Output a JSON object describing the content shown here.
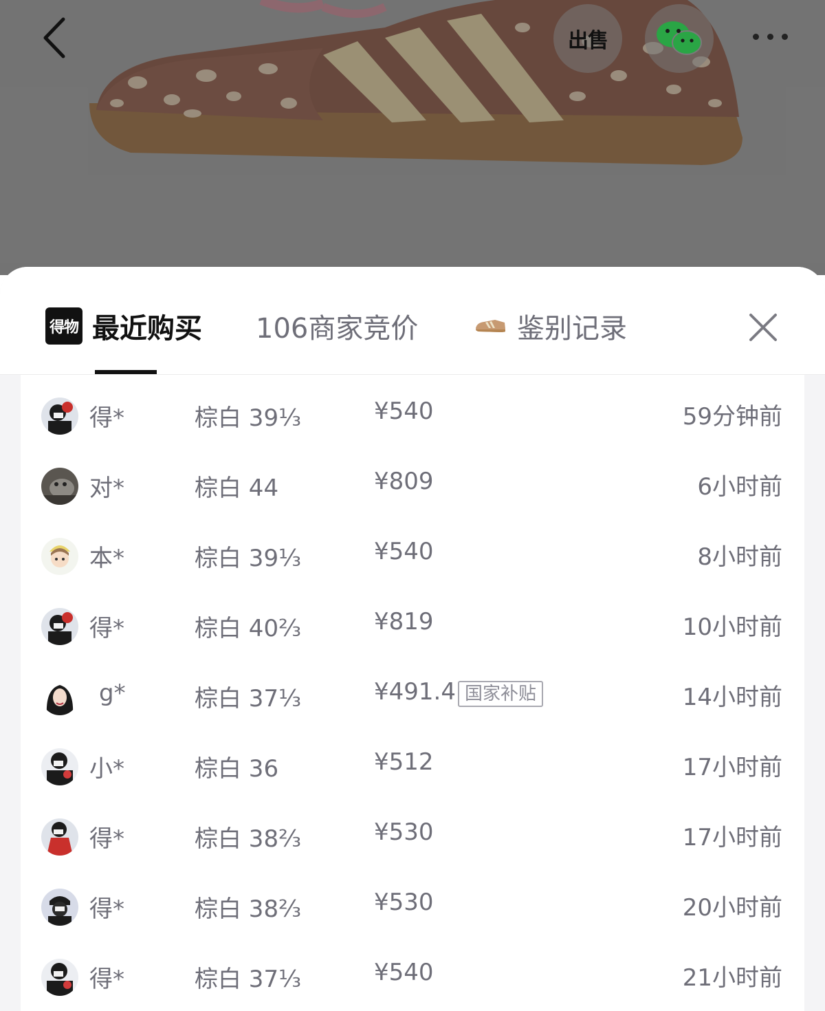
{
  "header": {
    "sell_label": "出售",
    "back_icon": "chevron-left-icon",
    "wechat_icon": "wechat-icon",
    "more_icon": "more-icon"
  },
  "sheet": {
    "tabs": [
      {
        "label": "最近购买",
        "logo_text": "得物",
        "active": true
      },
      {
        "label": "106商家竞价",
        "active": false
      },
      {
        "label": "鉴别记录",
        "active": false
      }
    ],
    "close_icon": "close-icon"
  },
  "purchases": [
    {
      "user": "得*",
      "spec": "棕白 39⅓",
      "price": "¥540",
      "badge": "",
      "time": "59分钟前"
    },
    {
      "user": "对*",
      "spec": "棕白 44",
      "price": "¥809",
      "badge": "",
      "time": "6小时前"
    },
    {
      "user": "本*",
      "spec": "棕白 39⅓",
      "price": "¥540",
      "badge": "",
      "time": "8小时前"
    },
    {
      "user": "得*",
      "spec": "棕白 40⅔",
      "price": "¥819",
      "badge": "",
      "time": "10小时前"
    },
    {
      "user": "g*",
      "spec": "棕白 37⅓",
      "price": "¥491.4",
      "badge": "国家补贴",
      "time": "14小时前"
    },
    {
      "user": "小*",
      "spec": "棕白 36",
      "price": "¥512",
      "badge": "",
      "time": "17小时前"
    },
    {
      "user": "得*",
      "spec": "棕白 38⅔",
      "price": "¥530",
      "badge": "",
      "time": "17小时前"
    },
    {
      "user": "得*",
      "spec": "棕白 38⅔",
      "price": "¥530",
      "badge": "",
      "time": "20小时前"
    },
    {
      "user": "得*",
      "spec": "棕白 37⅓",
      "price": "¥540",
      "badge": "",
      "time": "21小时前"
    }
  ],
  "colors": {
    "accent": "#111111",
    "muted_text": "#6e6e78",
    "wechat_green": "#2aa545"
  }
}
